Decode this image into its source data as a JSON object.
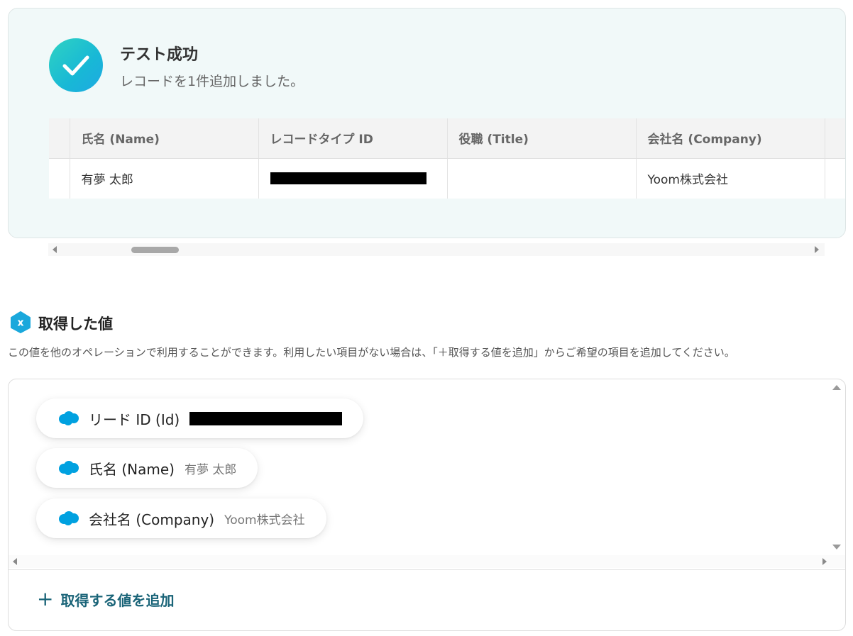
{
  "test_result": {
    "title": "テスト成功",
    "message": "レコードを1件追加しました。",
    "columns": [
      "氏名 (Name)",
      "レコードタイプ ID",
      "役職 (Title)",
      "会社名 (Company)"
    ],
    "rows": [
      [
        "有夢 太郎",
        "",
        "",
        "Yoom株式会社"
      ]
    ]
  },
  "acquired_values": {
    "title": "取得した値",
    "description": "この値を他のオペレーションで利用することができます。利用したい項目がない場合は、「＋取得する値を追加」からご希望の項目を追加してください。",
    "items": [
      {
        "label": "リード ID (Id)",
        "value": ""
      },
      {
        "label": "氏名 (Name)",
        "value": "有夢 太郎"
      },
      {
        "label": "会社名 (Company)",
        "value": "Yoom株式会社"
      }
    ],
    "add_button_label": "取得する値を追加",
    "add_button_icon": "plus-icon"
  },
  "icons": {
    "success": "check-icon",
    "section": "yoom-x-icon",
    "item": "salesforce-cloud-icon"
  },
  "colors": {
    "accent": "#1a6478",
    "success_gradient_start": "#2fd3c2",
    "success_gradient_end": "#1ea9e2",
    "salesforce_blue": "#00a1e0"
  }
}
